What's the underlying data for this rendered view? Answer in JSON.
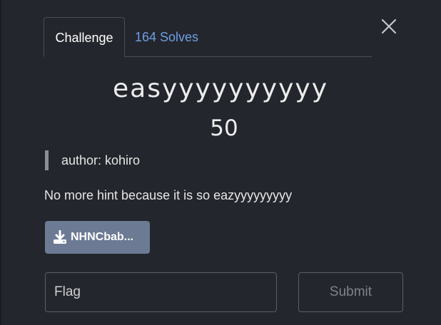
{
  "tabs": {
    "challenge_label": "Challenge",
    "solves_label": "164 Solves"
  },
  "challenge": {
    "name": "easyyyyyyyyyy",
    "points": "50",
    "author": "author: kohiro",
    "description": "No more hint because it is so eazyyyyyyyyy",
    "file_label": "NHNCbab..."
  },
  "form": {
    "flag_placeholder": "Flag",
    "submit_label": "Submit"
  },
  "colors": {
    "background": "#23262c",
    "link": "#6f9fe6",
    "file_button": "#6c7a93",
    "border": "#4a4e57"
  },
  "icons": {
    "close": "close-icon",
    "download": "download-icon"
  }
}
